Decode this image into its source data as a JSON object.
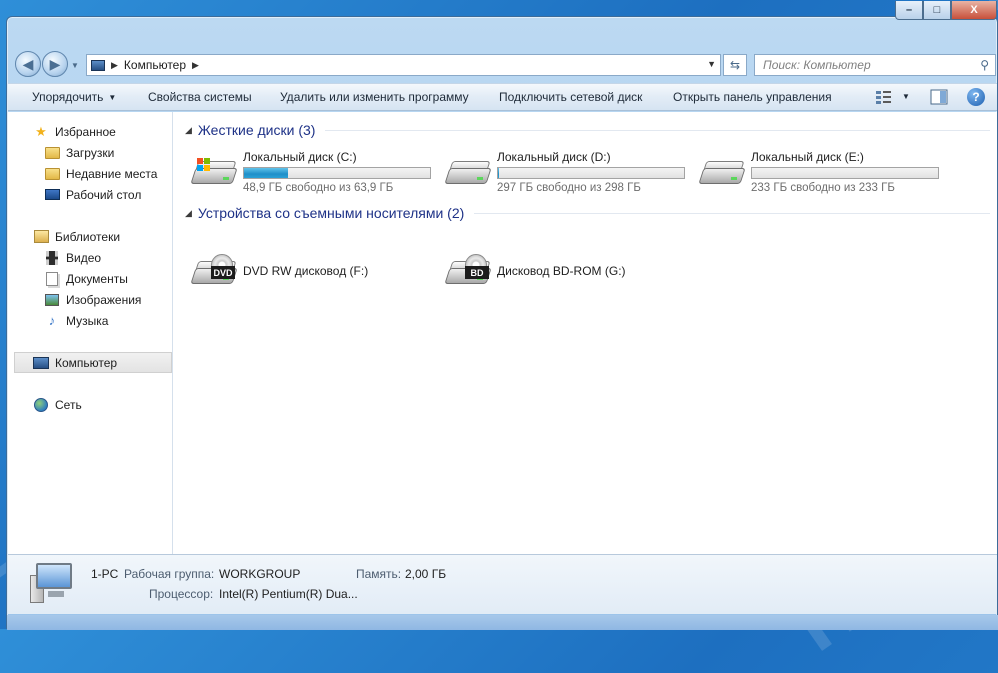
{
  "window": {
    "caption_min": "–",
    "caption_max": "□",
    "caption_close": "X"
  },
  "address": {
    "crumb": "Компьютер",
    "search_placeholder": "Поиск: Компьютер"
  },
  "toolbar": {
    "organize": "Упорядочить",
    "system_properties": "Свойства системы",
    "uninstall": "Удалить или изменить программу",
    "map_drive": "Подключить сетевой диск",
    "control_panel": "Открыть панель управления",
    "help": "?"
  },
  "sidebar": {
    "favorites": "Избранное",
    "downloads": "Загрузки",
    "recent": "Недавние места",
    "desktop": "Рабочий стол",
    "libraries": "Библиотеки",
    "video": "Видео",
    "documents": "Документы",
    "images": "Изображения",
    "music": "Музыка",
    "computer": "Компьютер",
    "network": "Сеть"
  },
  "groups": {
    "hard_disks": "Жесткие диски (3)",
    "removable": "Устройства со съемными носителями (2)"
  },
  "drives": [
    {
      "name": "Локальный диск (C:)",
      "free": "48,9 ГБ свободно из 63,9 ГБ",
      "used_fraction": 0.235,
      "system": true
    },
    {
      "name": "Локальный диск (D:)",
      "free": "297 ГБ свободно из 298 ГБ",
      "used_fraction": 0.003,
      "system": false
    },
    {
      "name": "Локальный диск (E:)",
      "free": "233 ГБ свободно из 233 ГБ",
      "used_fraction": 0.0,
      "system": false
    }
  ],
  "removable": [
    {
      "name": "DVD RW дисковод (F:)",
      "badge": "DVD"
    },
    {
      "name": "Дисковод BD-ROM (G:)",
      "badge": "BD"
    }
  ],
  "details": {
    "pc_name": "1-PC",
    "workgroup_label": "Рабочая группа:",
    "workgroup_value": "WORKGROUP",
    "memory_label": "Память:",
    "memory_value": "2,00 ГБ",
    "cpu_label": "Процессор:",
    "cpu_value": "Intel(R) Pentium(R) Dua..."
  },
  "watermark": "TMCARS",
  "colors": {
    "group_heading": "#1e3287",
    "usage_fill": "#1f8fc9",
    "desktop_bg": "#2a86d3"
  }
}
